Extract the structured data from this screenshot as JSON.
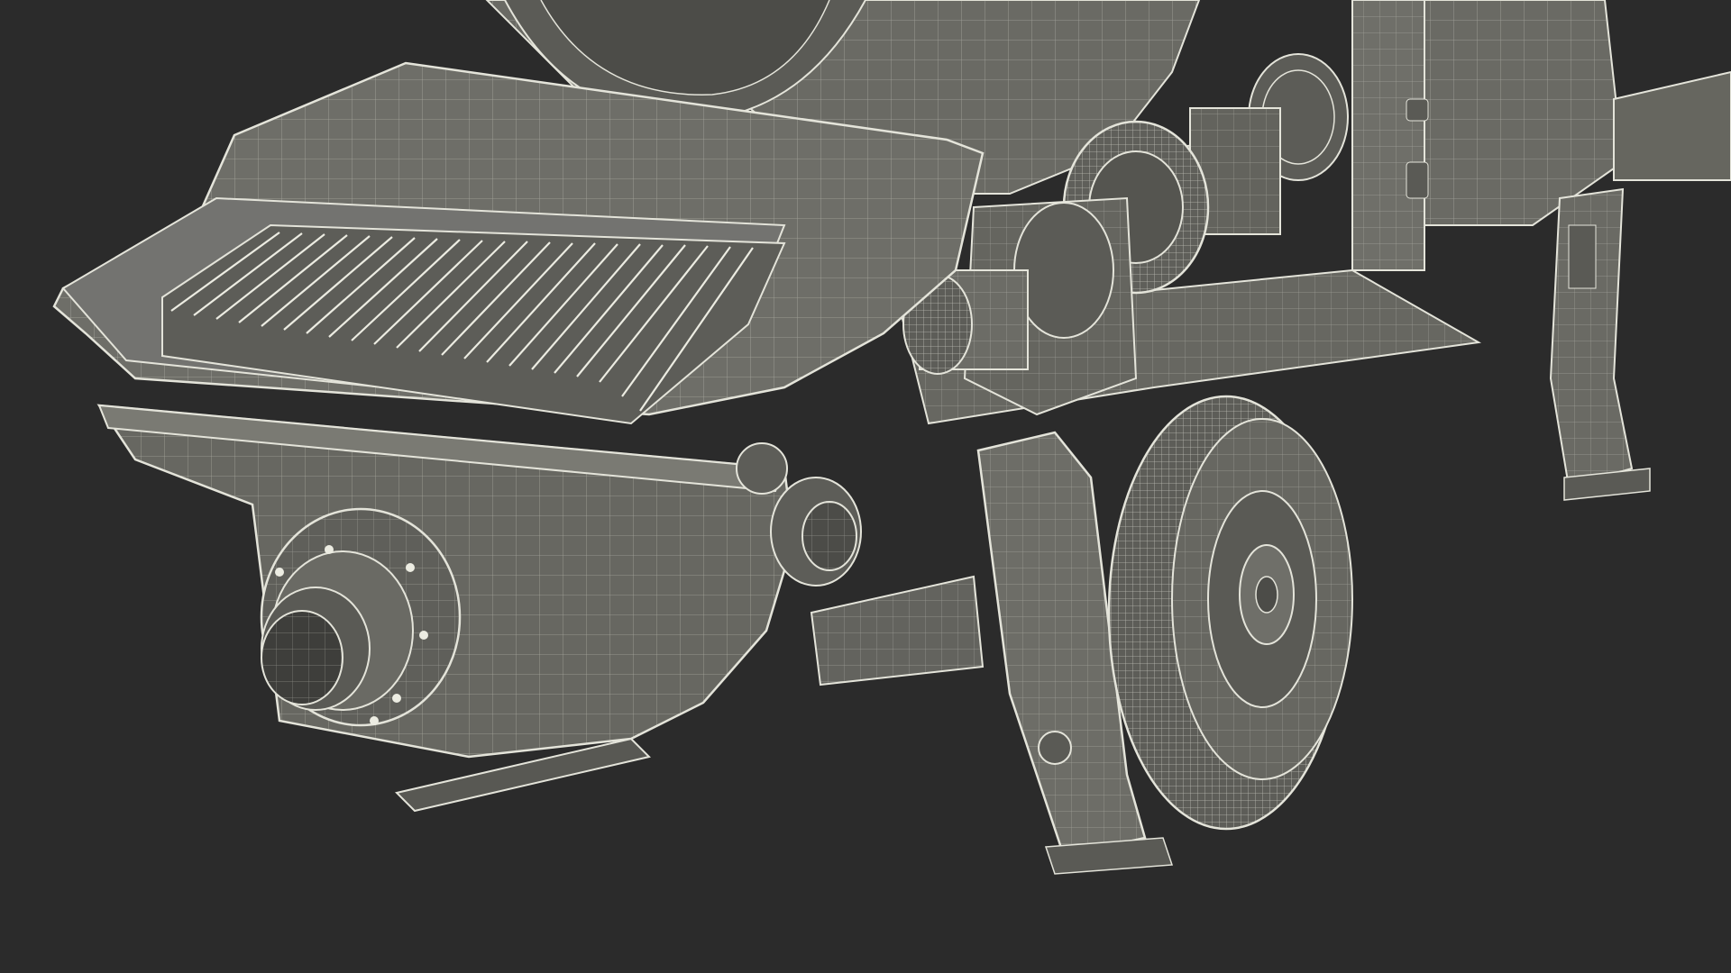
{
  "scene": {
    "background_color": "#2b2b2b",
    "model_fill": "#6f6f69",
    "model_fill_dark": "#5a5a55",
    "model_fill_light": "#7c7c75",
    "wire_color": "#e4e4da",
    "wire_color_dim": "#bdbdb3"
  }
}
